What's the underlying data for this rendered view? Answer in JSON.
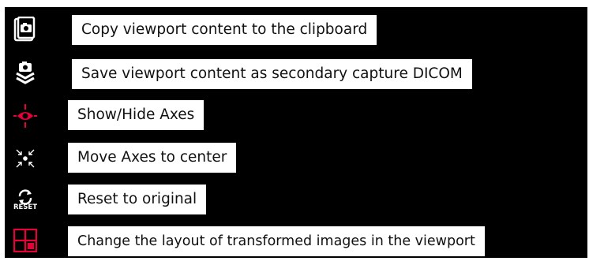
{
  "tooltips": {
    "copy": "Copy viewport content to the clipboard",
    "save": "Save viewport content as secondary capture DICOM",
    "axes": "Show/Hide Axes",
    "center": "Move Axes to center",
    "reset": "Reset to original",
    "layout": "Change the layout of transformed images in the viewport"
  },
  "icons": {
    "copy": "clipboard-camera-icon",
    "save": "save-capture-icon",
    "axes": "crosshair-eye-icon",
    "center": "arrows-to-center-icon",
    "reset": "reset-icon",
    "layout": "layout-grid-icon",
    "reset_caption": "RESET"
  },
  "colors": {
    "background": "#000000",
    "label_background": "#ffffff",
    "accent": "#e8003a"
  }
}
